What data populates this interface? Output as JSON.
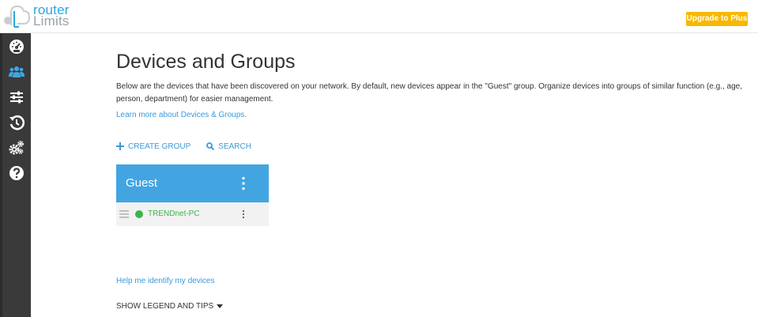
{
  "header": {
    "logo_line1": "router",
    "logo_line2": "Limits",
    "upgrade_label": "Upgrade to Plus"
  },
  "sidebar": {
    "items": [
      {
        "name": "dashboard",
        "icon": "dashboard-gauge-icon",
        "active": false
      },
      {
        "name": "devices",
        "icon": "users-icon",
        "active": true
      },
      {
        "name": "settings",
        "icon": "sliders-icon",
        "active": false
      },
      {
        "name": "history",
        "icon": "history-icon",
        "active": false
      },
      {
        "name": "advanced",
        "icon": "gears-icon",
        "active": false
      },
      {
        "name": "help",
        "icon": "question-circle-icon",
        "active": false
      }
    ],
    "active_color": "#42a5e2"
  },
  "main": {
    "title": "Devices and Groups",
    "description": "Below are the devices that have been discovered on your network. By default, new devices appear in the \"Guest\" group. Organize devices into groups of similar function (e.g., age, person, department) for easier management.",
    "learn_more": "Learn more about Devices & Groups.",
    "actions": {
      "create_group": "CREATE GROUP",
      "search": "SEARCH"
    },
    "groups": [
      {
        "name": "Guest",
        "devices": [
          {
            "name": "TRENDnet-PC",
            "status": "online"
          }
        ]
      }
    ],
    "help_link": "Help me identify my devices",
    "legend_toggle": "SHOW LEGEND AND TIPS"
  },
  "colors": {
    "accent": "#42a5e2",
    "link": "#3a9ad9",
    "online": "#3cb54a",
    "upgrade": "#f8b800",
    "sidebar_bg": "#3a3a3a"
  }
}
